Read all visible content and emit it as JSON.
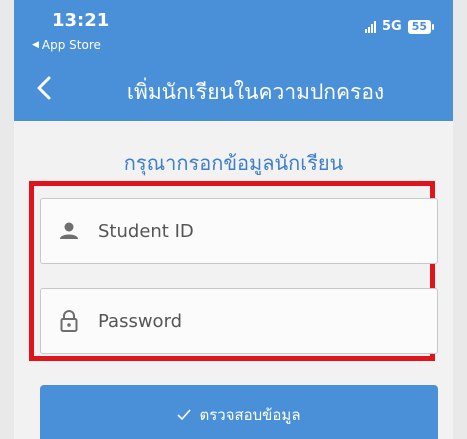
{
  "status_bar": {
    "time": "13:21",
    "back_app": "App Store",
    "network": "5G",
    "battery": "55"
  },
  "header": {
    "title": "เพิ่มนักเรียนในความปกครอง",
    "back_icon": "chevron-left-icon"
  },
  "form": {
    "title": "กรุณากรอกข้อมูลนักเรียน",
    "student_id": {
      "placeholder": "Student ID",
      "icon": "person-icon"
    },
    "password": {
      "placeholder": "Password",
      "icon": "lock-icon"
    },
    "submit_label": "ตรวจสอบข้อมูล",
    "submit_icon": "check-icon"
  },
  "colors": {
    "primary": "#4a90d9",
    "title_text": "#3d7fcc",
    "highlight_border": "#e0141b"
  }
}
